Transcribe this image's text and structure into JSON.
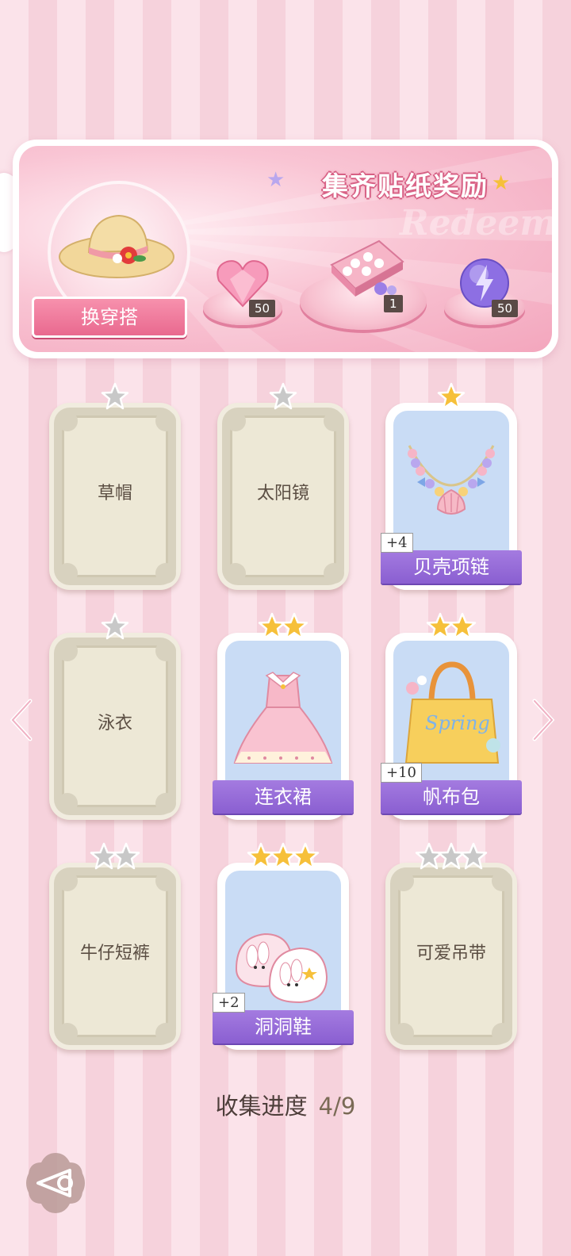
{
  "banner": {
    "title": "集齐贴纸奖励",
    "watermark": "Redeem",
    "outfit_button_label": "换穿搭",
    "rewards": [
      {
        "icon": "pink-heart-gem-icon",
        "count": "50"
      },
      {
        "icon": "sticker-gift-box-icon",
        "count": "1"
      },
      {
        "icon": "purple-energy-orb-icon",
        "count": "50"
      }
    ]
  },
  "cards": [
    {
      "name": "草帽",
      "stars": 1,
      "state": "locked"
    },
    {
      "name": "太阳镜",
      "stars": 1,
      "state": "locked"
    },
    {
      "name": "贝壳项链",
      "stars": 1,
      "state": "owned",
      "extra": "+4",
      "icon": "shell-necklace-icon"
    },
    {
      "name": "泳衣",
      "stars": 1,
      "state": "locked"
    },
    {
      "name": "连衣裙",
      "stars": 2,
      "state": "owned",
      "icon": "pink-dress-icon"
    },
    {
      "name": "帆布包",
      "stars": 2,
      "state": "owned",
      "extra": "+10",
      "icon": "canvas-bag-icon"
    },
    {
      "name": "牛仔短裤",
      "stars": 2,
      "state": "locked"
    },
    {
      "name": "洞洞鞋",
      "stars": 3,
      "state": "owned",
      "extra": "+2",
      "icon": "bunny-clogs-icon"
    },
    {
      "name": "可爱吊带",
      "stars": 3,
      "state": "locked"
    }
  ],
  "progress": {
    "label": "收集进度",
    "value": "4/9"
  },
  "colors": {
    "gold_star": "#f6c03a",
    "grey_star": "#c8c8c8",
    "ribbon": "#8a5fd1",
    "accent_pink": "#e9698f"
  }
}
